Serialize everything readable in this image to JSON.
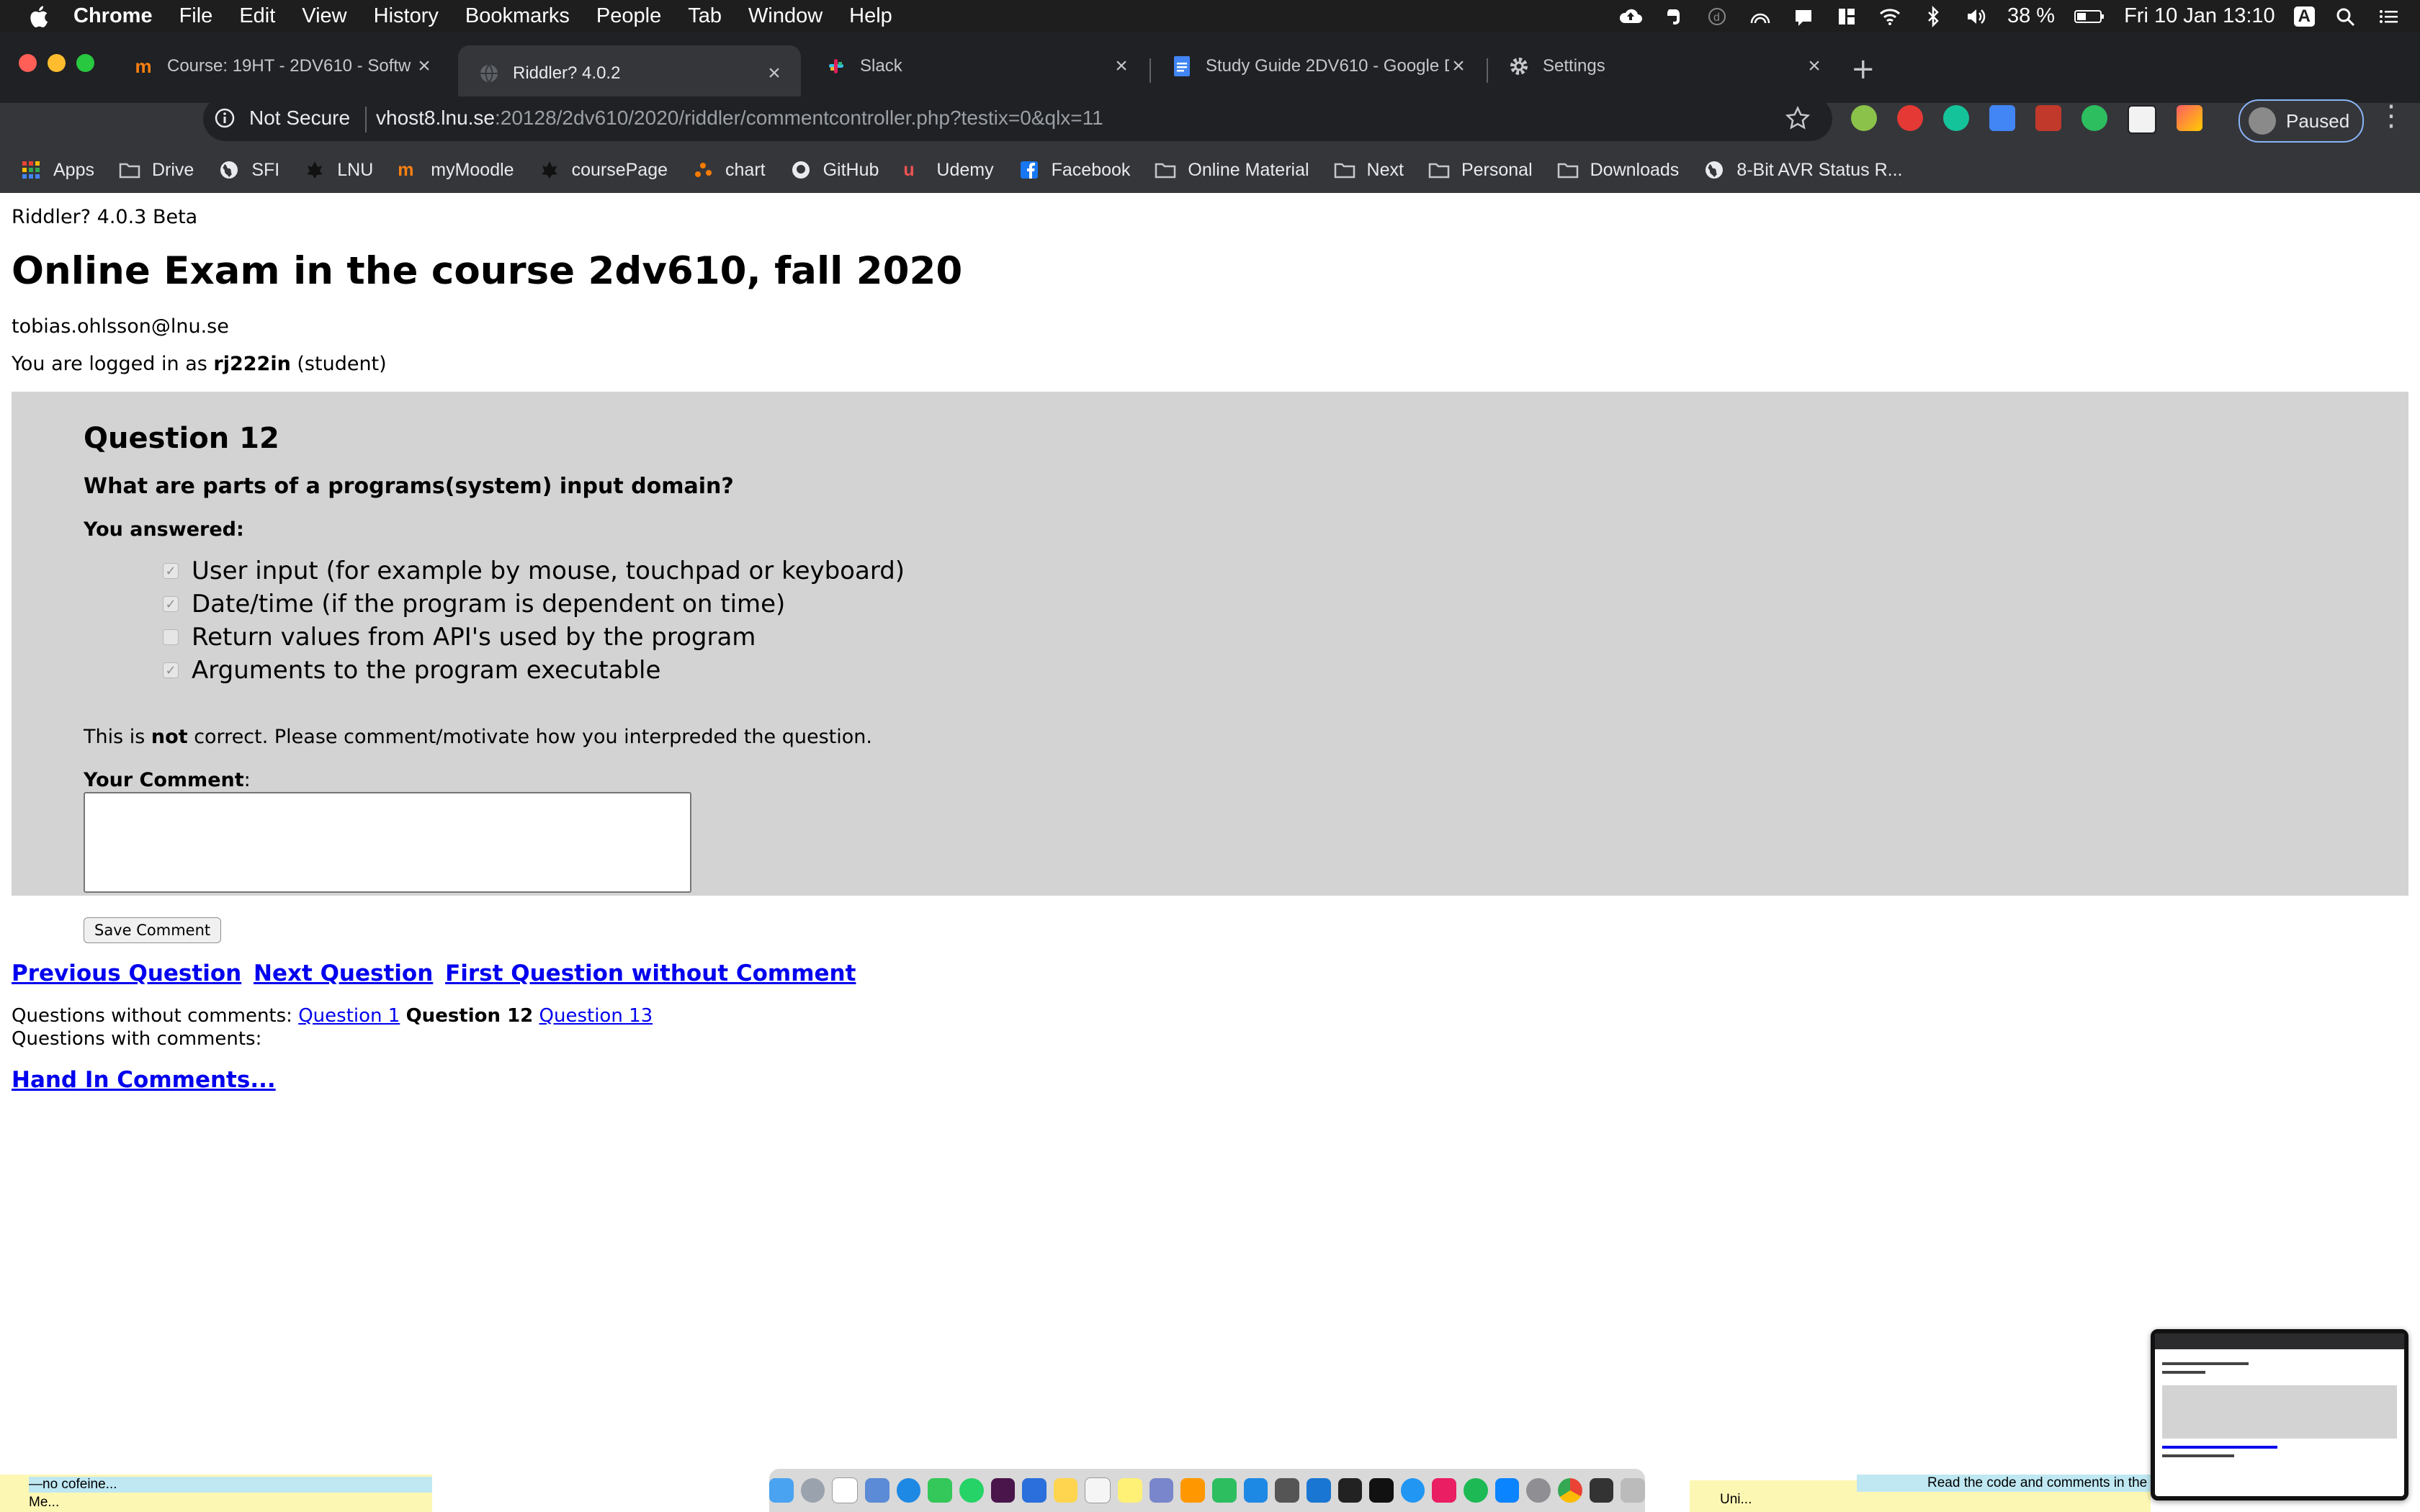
{
  "menubar": {
    "app": "Chrome",
    "items": [
      "File",
      "Edit",
      "View",
      "History",
      "Bookmarks",
      "People",
      "Tab",
      "Window",
      "Help"
    ],
    "battery": "38 %",
    "datetime": "Fri 10 Jan  13:10",
    "input_source": "A"
  },
  "tabs": [
    {
      "title": "Course: 19HT - 2DV610 - Softw",
      "favicon": "moodle-icon"
    },
    {
      "title": "Riddler? 4.0.2",
      "favicon": "globe-icon"
    },
    {
      "title": "Slack",
      "favicon": "slack-icon"
    },
    {
      "title": "Study Guide 2DV610 - Google D",
      "favicon": "google-docs-icon"
    },
    {
      "title": "Settings",
      "favicon": "gear-icon"
    }
  ],
  "omnibox": {
    "security_label": "Not Secure",
    "url_host": "vhost8.lnu.se",
    "url_path": ":20128/2dv610/2020/riddler/commentcontroller.php?testix=0&qlx=11"
  },
  "profile": {
    "label": "Paused"
  },
  "bookmarks": [
    {
      "label": "Apps",
      "icon": "apps-grid-icon"
    },
    {
      "label": "Drive",
      "icon": "folder-icon"
    },
    {
      "label": "SFI",
      "icon": "globe-icon"
    },
    {
      "label": "LNU",
      "icon": "lnu-icon"
    },
    {
      "label": "myMoodle",
      "icon": "moodle-icon"
    },
    {
      "label": "coursePage",
      "icon": "lnu-icon"
    },
    {
      "label": "chart",
      "icon": "chart-icon"
    },
    {
      "label": "GitHub",
      "icon": "github-icon"
    },
    {
      "label": "Udemy",
      "icon": "udemy-icon"
    },
    {
      "label": "Facebook",
      "icon": "facebook-icon"
    },
    {
      "label": "Online Material",
      "icon": "folder-icon"
    },
    {
      "label": "Next",
      "icon": "folder-icon"
    },
    {
      "label": "Personal",
      "icon": "folder-icon"
    },
    {
      "label": "Downloads",
      "icon": "folder-icon"
    },
    {
      "label": "8-Bit AVR Status R...",
      "icon": "globe-icon"
    }
  ],
  "page": {
    "version": "Riddler? 4.0.3 Beta",
    "title": "Online Exam in the course 2dv610, fall 2020",
    "email": "tobias.ohlsson@lnu.se",
    "login_prefix": "You are logged in as ",
    "login_user": "rj222in",
    "login_role": " (student)"
  },
  "question": {
    "heading": "Question 12",
    "text": "What are parts of a programs(system) input domain?",
    "answered_label": "You answered:",
    "options": [
      {
        "label": "User input (for example by mouse, touchpad or keyboard)",
        "checked": true
      },
      {
        "label": "Date/time (if the program is dependent on time)",
        "checked": true
      },
      {
        "label": "Return values from API's used by the program",
        "checked": false
      },
      {
        "label": "Arguments to the program executable",
        "checked": true
      }
    ],
    "feedback_pre": "This is ",
    "feedback_bold": "not",
    "feedback_post": " correct. Please comment/motivate how you interpreded the question.",
    "comment_label": "Your Comment",
    "comment_colon": ":",
    "comment_value": "",
    "save_label": "Save Comment"
  },
  "nav": {
    "previous": "Previous Question",
    "next": "Next Question",
    "first_without": "First Question without Comment"
  },
  "status": {
    "without_label": "Questions without comments: ",
    "without_link1": "Question 1",
    "without_current": "Question 12",
    "without_link2": "Question 13",
    "with_label": "Questions with comments:",
    "handin": "Hand In Comments..."
  },
  "overlays": {
    "sticky_left_line1": "—no cofeine...",
    "sticky_left_line2": "Me...",
    "sticky_mid": "Uni...",
    "sticky_right": "Read the code and comments in the di"
  }
}
